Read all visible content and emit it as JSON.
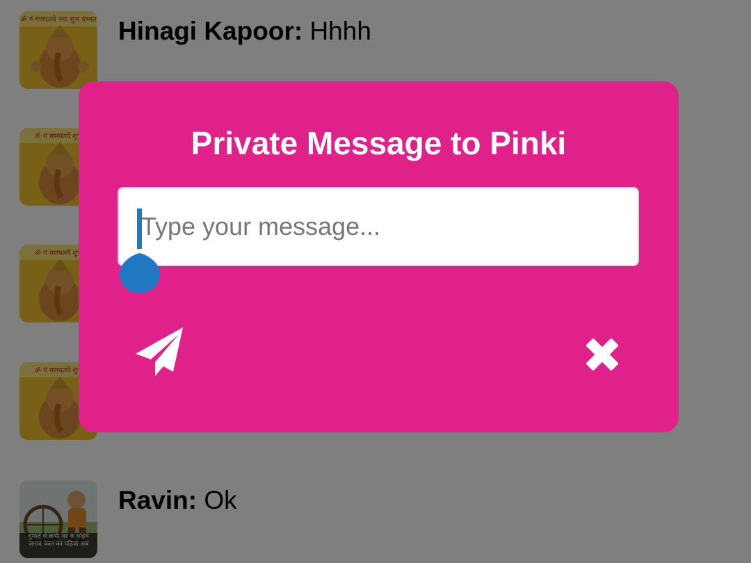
{
  "chat": {
    "items": [
      {
        "sender": "Hinagi Kapoor:",
        "message": " Hhhh",
        "avatar": "ganesha-image-avatar",
        "avatar_caption": "ॐ गं गणपतये नमः शुभ प्रभात"
      },
      {
        "sender": "",
        "message": "",
        "avatar": "ganesha-image-avatar",
        "avatar_caption": "ॐ गं गणपतये शुभ"
      },
      {
        "sender": "",
        "message": "",
        "avatar": "ganesha-image-avatar",
        "avatar_caption": "ॐ गं गणपतये शुभ"
      },
      {
        "sender": "",
        "message": "",
        "avatar": "ganesha-image-avatar",
        "avatar_caption": "ॐ गं गणपतये शुभ"
      },
      {
        "sender": "Ravin:",
        "message": " Ok",
        "avatar": "boy-with-wheel-avatar",
        "avatar_caption": "घुमाते थे कभी घर के पहिये जनाब वक्त का पहिया अब"
      }
    ]
  },
  "dialog": {
    "title": "Private Message to Pinki",
    "input_placeholder": "Type your message...",
    "input_value": "",
    "send_icon": "paper-plane-icon",
    "close_icon": "close-x-icon"
  },
  "colors": {
    "dialog_background": "#e0218a",
    "overlay": "rgba(0,0,0,0.5)",
    "cursor": "#1f78c1",
    "text_on_dialog": "#ffffff"
  }
}
